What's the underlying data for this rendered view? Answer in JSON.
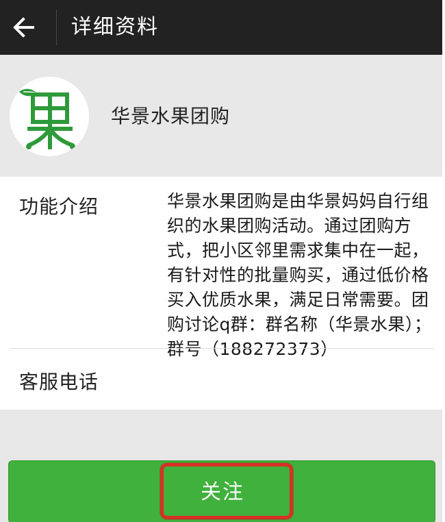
{
  "topbar": {
    "title": "详细资料",
    "back_icon": "arrow-left-icon"
  },
  "profile": {
    "avatar_icon": "fruit-logo",
    "avatar_text": "果",
    "name": "华景水果团购"
  },
  "info": {
    "intro_label": "功能介绍",
    "intro_text": "华景水果团购是由华景妈妈自行组织的水果团购活动。通过团购方式，把小区邻里需求集中在一起，有针对性的批量购买，通过低价格买入优质水果，满足日常需要。团购讨论q群：群名称（华景水果）；群号（188272373）",
    "phone_label": "客服电话"
  },
  "follow": {
    "label": "关注"
  },
  "colors": {
    "topbar": "#222222",
    "background": "#e7e7e7",
    "button_green": "#3fb13c",
    "highlight_red": "#d93025",
    "logo_green": "#2e9a3a"
  }
}
